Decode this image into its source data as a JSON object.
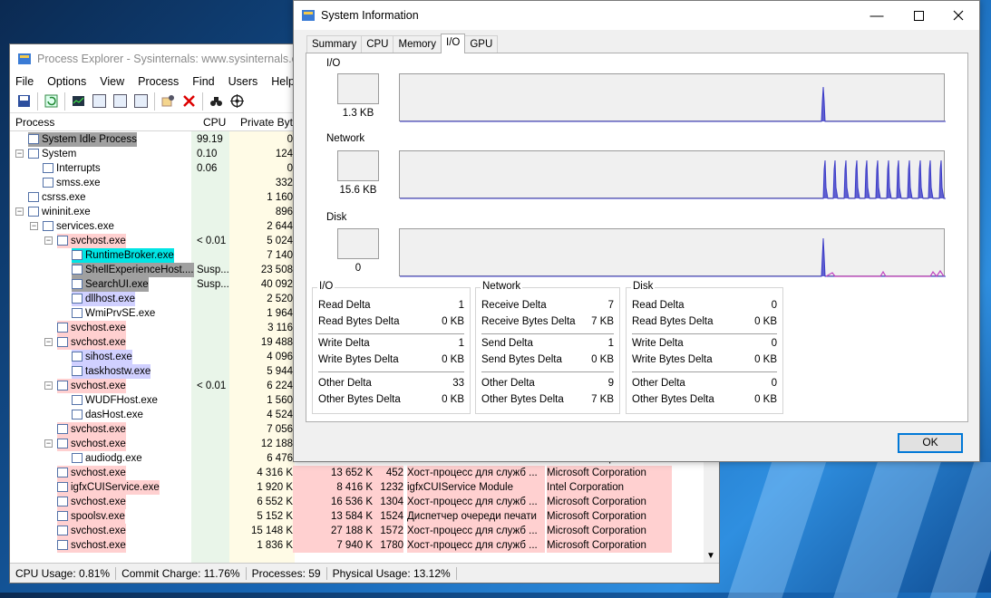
{
  "process_explorer": {
    "title": "Process Explorer - Sysinternals: www.sysinternals.com",
    "menu": [
      "File",
      "Options",
      "View",
      "Process",
      "Find",
      "Users",
      "Help"
    ],
    "toolbar_icons": [
      "save-icon",
      "refresh-icon",
      "system-info-icon",
      "properties-icon",
      "window-icon",
      "dll-icon",
      "find-window-icon",
      "kill-process-icon",
      "find-binoculars-icon",
      "target-icon"
    ],
    "columns": {
      "process": "Process",
      "cpu": "CPU",
      "private_bytes": "Private Bytes"
    },
    "rows": [
      {
        "name": "System Idle Process",
        "indent": 0,
        "expand": "",
        "cpu": "99.19",
        "pb": "0",
        "ws": "",
        "pid": "",
        "desc": "",
        "company": "",
        "hl": "grayhl"
      },
      {
        "name": "System",
        "indent": 0,
        "expand": "−",
        "cpu": "0.10",
        "pb": "124",
        "ws": "",
        "pid": "",
        "desc": "",
        "company": "",
        "hl": ""
      },
      {
        "name": "Interrupts",
        "indent": 1,
        "expand": "",
        "cpu": "0.06",
        "pb": "0",
        "ws": "",
        "pid": "",
        "desc": "",
        "company": "",
        "hl": ""
      },
      {
        "name": "smss.exe",
        "indent": 1,
        "expand": "",
        "cpu": "",
        "pb": "332",
        "ws": "",
        "pid": "",
        "desc": "",
        "company": "",
        "hl": ""
      },
      {
        "name": "csrss.exe",
        "indent": 0,
        "expand": "",
        "cpu": "",
        "pb": "1 160",
        "ws": "",
        "pid": "",
        "desc": "",
        "company": "",
        "hl": ""
      },
      {
        "name": "wininit.exe",
        "indent": 0,
        "expand": "−",
        "cpu": "",
        "pb": "896",
        "ws": "",
        "pid": "",
        "desc": "",
        "company": "",
        "hl": ""
      },
      {
        "name": "services.exe",
        "indent": 1,
        "expand": "−",
        "cpu": "",
        "pb": "2 644",
        "ws": "",
        "pid": "",
        "desc": "",
        "company": "",
        "hl": ""
      },
      {
        "name": "svchost.exe",
        "indent": 2,
        "expand": "−",
        "cpu": "< 0.01",
        "pb": "5 024",
        "ws": "",
        "pid": "",
        "desc": "",
        "company": "",
        "hl": "pink"
      },
      {
        "name": "RuntimeBroker.exe",
        "indent": 3,
        "expand": "",
        "cpu": "",
        "pb": "7 140",
        "ws": "",
        "pid": "",
        "desc": "",
        "company": "",
        "hl": "cyan"
      },
      {
        "name": "ShellExperienceHost....",
        "indent": 3,
        "expand": "",
        "cpu": "Susp...",
        "pb": "23 508",
        "ws": "",
        "pid": "",
        "desc": "",
        "company": "",
        "hl": "grayhl"
      },
      {
        "name": "SearchUI.exe",
        "indent": 3,
        "expand": "",
        "cpu": "Susp...",
        "pb": "40 092",
        "ws": "",
        "pid": "",
        "desc": "",
        "company": "",
        "hl": "grayhl"
      },
      {
        "name": "dllhost.exe",
        "indent": 3,
        "expand": "",
        "cpu": "",
        "pb": "2 520",
        "ws": "",
        "pid": "",
        "desc": "",
        "company": "",
        "hl": "lav"
      },
      {
        "name": "WmiPrvSE.exe",
        "indent": 3,
        "expand": "",
        "cpu": "",
        "pb": "1 964",
        "ws": "",
        "pid": "",
        "desc": "",
        "company": "",
        "hl": ""
      },
      {
        "name": "svchost.exe",
        "indent": 2,
        "expand": "",
        "cpu": "",
        "pb": "3 116",
        "ws": "",
        "pid": "",
        "desc": "",
        "company": "",
        "hl": "pink"
      },
      {
        "name": "svchost.exe",
        "indent": 2,
        "expand": "−",
        "cpu": "",
        "pb": "19 488",
        "ws": "",
        "pid": "",
        "desc": "",
        "company": "",
        "hl": "pink"
      },
      {
        "name": "sihost.exe",
        "indent": 3,
        "expand": "",
        "cpu": "",
        "pb": "4 096",
        "ws": "",
        "pid": "",
        "desc": "",
        "company": "",
        "hl": "lav"
      },
      {
        "name": "taskhostw.exe",
        "indent": 3,
        "expand": "",
        "cpu": "",
        "pb": "5 944",
        "ws": "",
        "pid": "",
        "desc": "",
        "company": "",
        "hl": "lav"
      },
      {
        "name": "svchost.exe",
        "indent": 2,
        "expand": "−",
        "cpu": "< 0.01",
        "pb": "6 224",
        "ws": "",
        "pid": "",
        "desc": "",
        "company": "",
        "hl": "pink"
      },
      {
        "name": "WUDFHost.exe",
        "indent": 3,
        "expand": "",
        "cpu": "",
        "pb": "1 560",
        "ws": "",
        "pid": "",
        "desc": "",
        "company": "",
        "hl": ""
      },
      {
        "name": "dasHost.exe",
        "indent": 3,
        "expand": "",
        "cpu": "",
        "pb": "4 524",
        "ws": "",
        "pid": "",
        "desc": "",
        "company": "",
        "hl": ""
      },
      {
        "name": "svchost.exe",
        "indent": 2,
        "expand": "",
        "cpu": "",
        "pb": "7 056",
        "ws": "",
        "pid": "",
        "desc": "",
        "company": "",
        "hl": "pink"
      },
      {
        "name": "svchost.exe",
        "indent": 2,
        "expand": "−",
        "cpu": "",
        "pb": "12 188",
        "ws": "",
        "pid": "",
        "desc": "",
        "company": "",
        "hl": "pink"
      },
      {
        "name": "audiodg.exe",
        "indent": 3,
        "expand": "",
        "cpu": "",
        "pb": "6 476",
        "ws": "",
        "pid": "",
        "desc": "",
        "company": "Microsoft Corporation",
        "hl": ""
      },
      {
        "name": "svchost.exe",
        "indent": 2,
        "expand": "",
        "cpu": "",
        "pb": "4 316 K",
        "ws": "13 652 K",
        "pid": "452",
        "desc": "Хост-процесс для служб ...",
        "company": "Microsoft Corporation",
        "hl": "pink"
      },
      {
        "name": "igfxCUIService.exe",
        "indent": 2,
        "expand": "",
        "cpu": "",
        "pb": "1 920 K",
        "ws": "8 416 K",
        "pid": "1232",
        "desc": "igfxCUIService Module",
        "company": "Intel Corporation",
        "hl": "pink"
      },
      {
        "name": "svchost.exe",
        "indent": 2,
        "expand": "",
        "cpu": "",
        "pb": "6 552 K",
        "ws": "16 536 K",
        "pid": "1304",
        "desc": "Хост-процесс для служб ...",
        "company": "Microsoft Corporation",
        "hl": "pink"
      },
      {
        "name": "spoolsv.exe",
        "indent": 2,
        "expand": "",
        "cpu": "",
        "pb": "5 152 K",
        "ws": "13 584 K",
        "pid": "1524",
        "desc": "Диспетчер очереди печати",
        "company": "Microsoft Corporation",
        "hl": "pink"
      },
      {
        "name": "svchost.exe",
        "indent": 2,
        "expand": "",
        "cpu": "",
        "pb": "15 148 K",
        "ws": "27 188 K",
        "pid": "1572",
        "desc": "Хост-процесс для служб ...",
        "company": "Microsoft Corporation",
        "hl": "pink"
      },
      {
        "name": "svchost.exe",
        "indent": 2,
        "expand": "",
        "cpu": "",
        "pb": "1 836 K",
        "ws": "7 940 K",
        "pid": "1780",
        "desc": "Хост-процесс для служб ...",
        "company": "Microsoft Corporation",
        "hl": "pink"
      }
    ],
    "status": {
      "cpu": "CPU Usage: 0.81%",
      "commit": "Commit Charge: 11.76%",
      "processes": "Processes: 59",
      "physical": "Physical Usage: 13.12%"
    }
  },
  "sysinfo": {
    "title": "System Information",
    "window_buttons": [
      "minimize-icon",
      "maximize-icon",
      "close-icon"
    ],
    "tabs": [
      "Summary",
      "CPU",
      "Memory",
      "I/O",
      "GPU"
    ],
    "active_tab": "I/O",
    "graphs": [
      {
        "label": "I/O",
        "value": "1.3  KB",
        "color": "#3b3bc8"
      },
      {
        "label": "Network",
        "value": "15.6  KB",
        "color": "#3b3bc8"
      },
      {
        "label": "Disk",
        "value": "0",
        "color": "#3b3bc8"
      }
    ],
    "groups": {
      "io": {
        "title": "I/O",
        "rows": [
          [
            "Read Delta",
            "1"
          ],
          [
            "Read Bytes Delta",
            "0 KB"
          ],
          [
            "Write Delta",
            "1"
          ],
          [
            "Write Bytes Delta",
            "0 KB"
          ],
          [
            "Other Delta",
            "33"
          ],
          [
            "Other Bytes Delta",
            "0 KB"
          ]
        ]
      },
      "network": {
        "title": "Network",
        "rows": [
          [
            "Receive Delta",
            "7"
          ],
          [
            "Receive Bytes Delta",
            "7 KB"
          ],
          [
            "Send Delta",
            "1"
          ],
          [
            "Send Bytes Delta",
            "0 KB"
          ],
          [
            "Other Delta",
            "9"
          ],
          [
            "Other Bytes Delta",
            "7 KB"
          ]
        ]
      },
      "disk": {
        "title": "Disk",
        "rows": [
          [
            "Read Delta",
            "0"
          ],
          [
            "Read Bytes Delta",
            "0 KB"
          ],
          [
            "Write Delta",
            "0"
          ],
          [
            "Write Bytes Delta",
            "0 KB"
          ],
          [
            "Other Delta",
            "0"
          ],
          [
            "Other Bytes Delta",
            "0 KB"
          ]
        ]
      }
    },
    "ok_label": "OK"
  },
  "colors": {
    "pink": "#ffd0d0",
    "cyan": "#00e5e5",
    "gray": "#a0a0a0",
    "lavender": "#d0d0ff",
    "graph_line": "#3b3bc8",
    "graph_magenta": "#c040c0"
  }
}
